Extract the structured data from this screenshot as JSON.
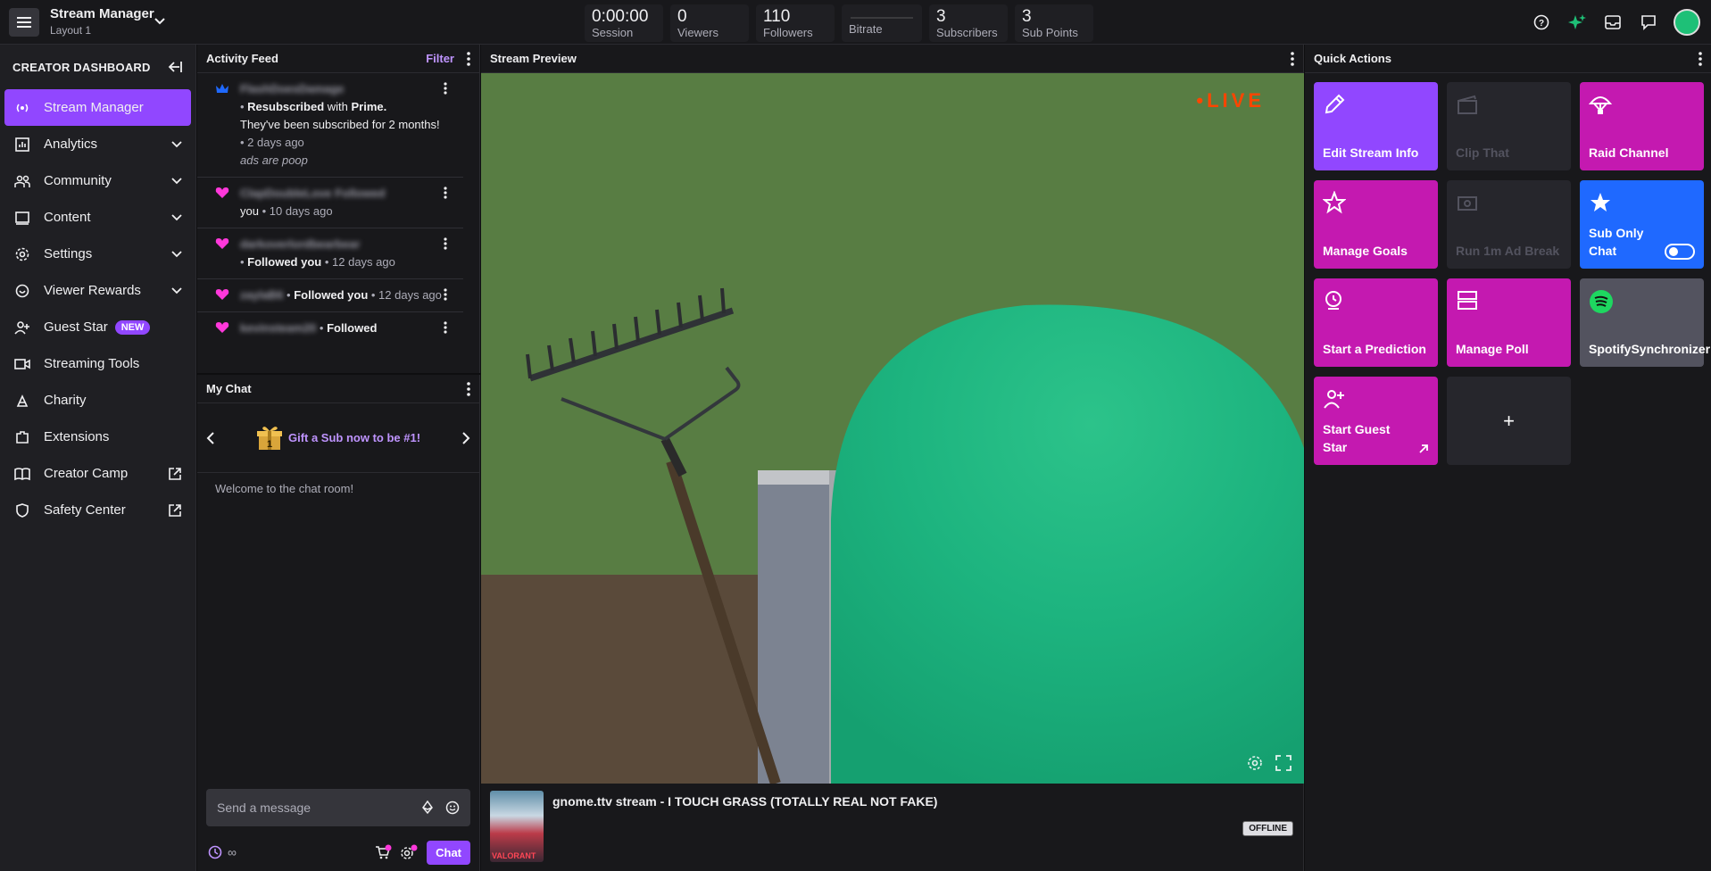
{
  "topbar": {
    "title": "Stream Manager",
    "layout": "Layout 1",
    "stats": [
      {
        "value": "0:00:00",
        "label": "Session"
      },
      {
        "value": "0",
        "label": "Viewers"
      },
      {
        "value": "110",
        "label": "Followers"
      },
      {
        "value": "",
        "label": "Bitrate"
      },
      {
        "value": "3",
        "label": "Subscribers"
      },
      {
        "value": "3",
        "label": "Sub Points"
      }
    ]
  },
  "sidebar": {
    "heading": "CREATOR DASHBOARD",
    "items": [
      {
        "label": "Stream Manager"
      },
      {
        "label": "Analytics"
      },
      {
        "label": "Community"
      },
      {
        "label": "Content"
      },
      {
        "label": "Settings"
      },
      {
        "label": "Viewer Rewards"
      },
      {
        "label": "Guest Star",
        "badge": "NEW"
      },
      {
        "label": "Streaming Tools"
      },
      {
        "label": "Charity"
      },
      {
        "label": "Extensions"
      },
      {
        "label": "Creator Camp"
      },
      {
        "label": "Safety Center"
      }
    ]
  },
  "activity": {
    "title": "Activity Feed",
    "filter": "Filter",
    "items": [
      {
        "user": "FlashDoesDamage",
        "action": "Resubscribed",
        "mid": " with ",
        "strong2": "Prime.",
        "text": "They've been subscribed for 2 months!",
        "time": "2 days ago",
        "message": "ads are poop"
      },
      {
        "user": "ClapDoubleLove",
        "action": "Followed",
        "text": "you",
        "time": "10 days ago"
      },
      {
        "user": "darkoverlordbearbear",
        "action": "Followed you",
        "time": "12 days ago"
      },
      {
        "user": "zaylaB6",
        "action": "Followed you",
        "time": "12 days ago"
      },
      {
        "user": "kevinsteam20",
        "action": "Followed"
      }
    ]
  },
  "chat": {
    "title": "My Chat",
    "gift": "Gift a Sub now to be #1!",
    "welcome": "Welcome to the chat room!",
    "placeholder": "Send a message",
    "infinity": "∞",
    "chat_button": "Chat"
  },
  "preview": {
    "title": "Stream Preview",
    "live": "•LIVE",
    "stream_title": "gnome.ttv stream - I TOUCH GRASS (TOTALLY REAL NOT FAKE)",
    "status": "OFFLINE",
    "game_label": "VALORANT"
  },
  "quick": {
    "title": "Quick Actions",
    "tiles": [
      {
        "label": "Edit Stream Info"
      },
      {
        "label": "Clip That"
      },
      {
        "label": "Raid Channel"
      },
      {
        "label": "Manage Goals"
      },
      {
        "label": "Run 1m Ad Break"
      },
      {
        "label": "Sub Only Chat"
      },
      {
        "label": "Start a Prediction"
      },
      {
        "label": "Manage Poll"
      },
      {
        "label": "SpotifySynchronizer"
      },
      {
        "label": "Start Guest Star"
      },
      {
        "label": "+"
      }
    ]
  },
  "colors": {
    "accent": "#9147ff",
    "magenta": "#c419b0",
    "blue": "#1f69ff",
    "live": "#ff4500",
    "bg": "#0e0e10"
  }
}
